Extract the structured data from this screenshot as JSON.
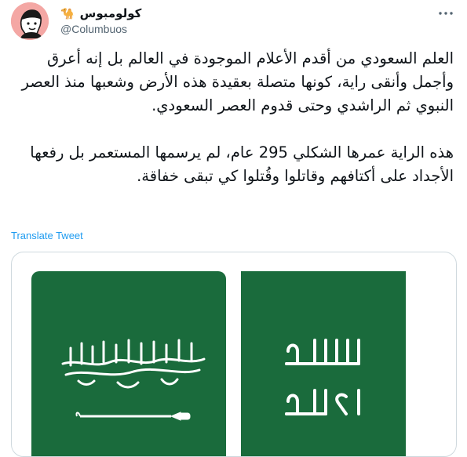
{
  "tweet": {
    "display_name": "كولومبوس",
    "name_emoji": "🐪",
    "handle": "@Columbuos",
    "paragraphs": [
      "العلم السعودي من أقدم الأعلام الموجودة في العالم بل إنه أعرق وأجمل وأنقى راية، كونها متصلة بعقيدة هذه الأرض وشعبها منذ العصر النبوي ثم الراشدي وحتى قدوم العصر السعودي.",
      "هذه الراية عمرها الشكلي 295 عام، لم يرسمها المستعمر بل رفعها الأجداد على أكتافهم وقاتلوا وقُتلوا كي تبقى خفاقة."
    ],
    "translate_label": "Translate Tweet"
  },
  "icons": {
    "more": "more-icon",
    "avatar": "avatar",
    "camel": "camel-emoji-icon"
  },
  "colors": {
    "link": "#1d9bf0",
    "flag_green": "#1a6b3c",
    "muted": "#536471"
  }
}
